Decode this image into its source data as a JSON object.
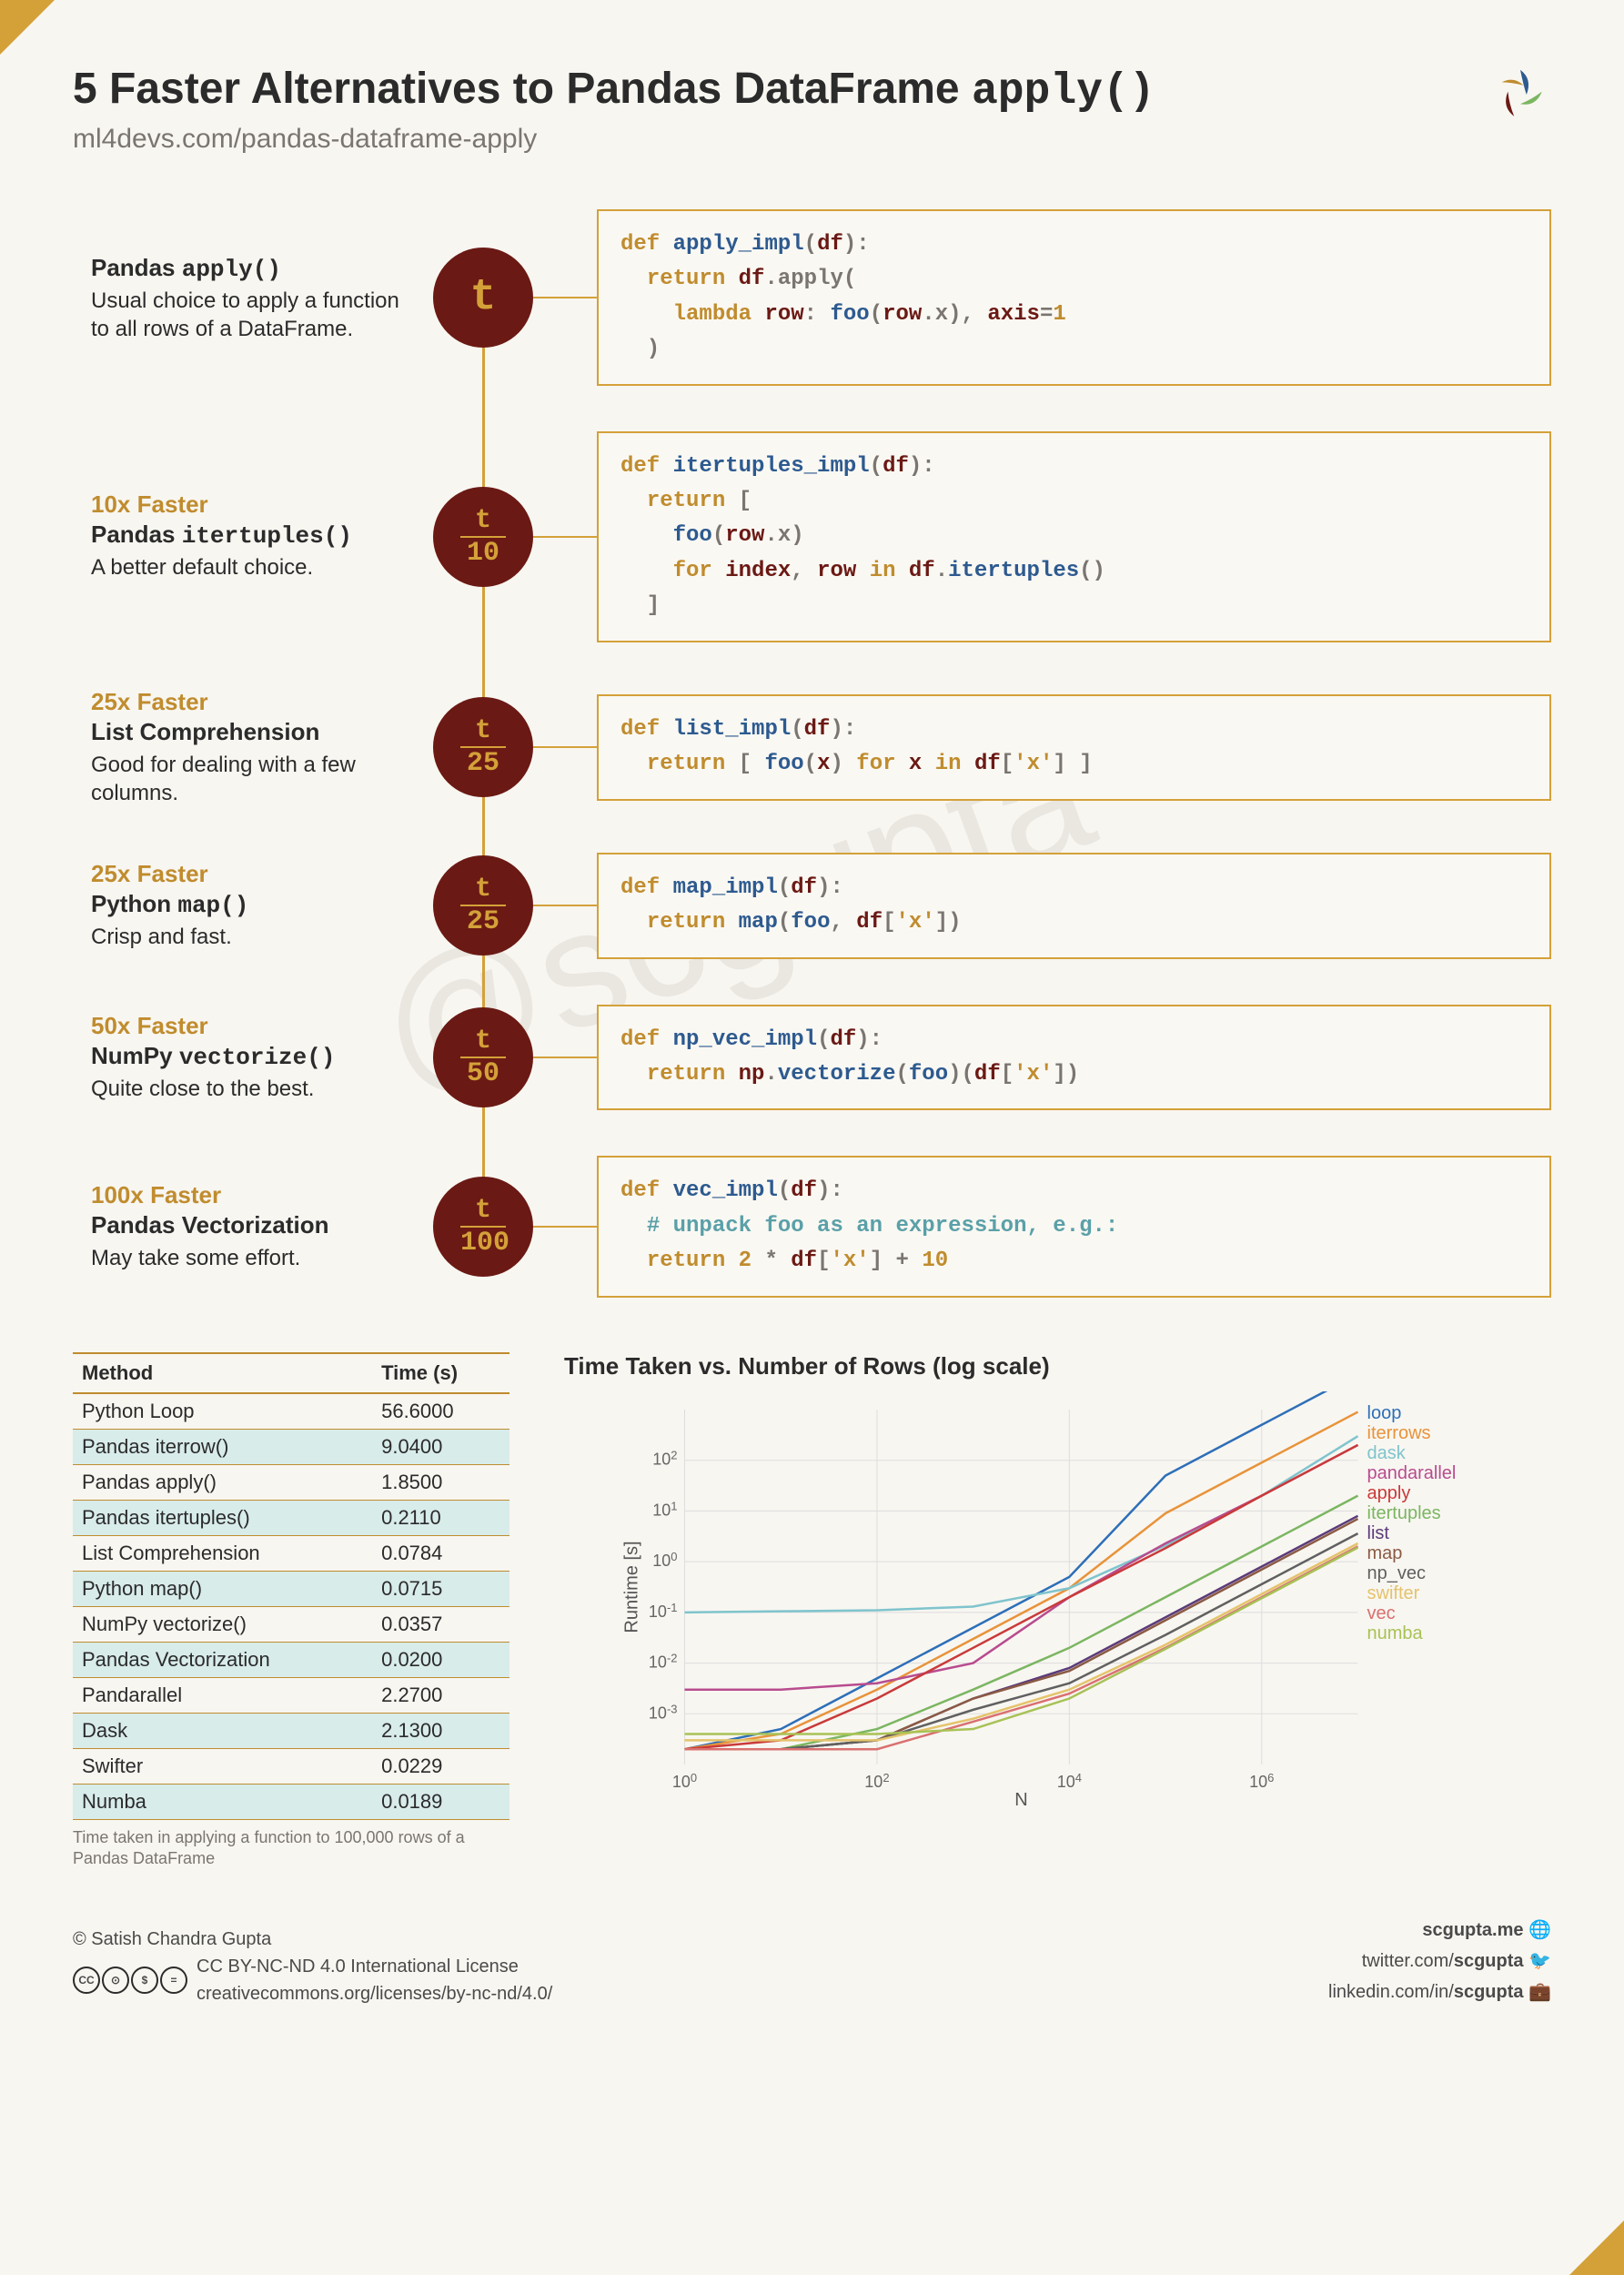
{
  "header": {
    "title_prefix": "5 Faster Alternatives to Pandas DataFrame ",
    "title_mono": "apply()",
    "subtitle": "ml4devs.com/pandas-dataframe-apply"
  },
  "methods": [
    {
      "speed": "",
      "title_text": "Pandas ",
      "title_mono": "apply()",
      "desc": "Usual choice to apply a function to all rows of a DataFrame.",
      "badge_t": "t",
      "badge_n": "",
      "code": "<span class='kw'>def</span> <span class='fn'>apply_impl</span>(<span class='var'>df</span>):\n  <span class='kw'>return</span> <span class='var'>df</span>.apply(\n    <span class='kw'>lambda</span> <span class='var'>row</span>: <span class='fn'>foo</span>(<span class='var'>row</span>.x), <span class='var'>axis</span>=<span class='op'>1</span>\n  )"
    },
    {
      "speed": "10x Faster",
      "title_text": "Pandas ",
      "title_mono": "itertuples()",
      "desc": "A better default choice.",
      "badge_t": "t",
      "badge_n": "10",
      "code": "<span class='kw'>def</span> <span class='fn'>itertuples_impl</span>(<span class='var'>df</span>):\n  <span class='kw'>return</span> [\n    <span class='fn'>foo</span>(<span class='var'>row</span>.x)\n    <span class='kw'>for</span> <span class='var'>index</span>, <span class='var'>row</span> <span class='kw'>in</span> <span class='var'>df</span>.<span class='fn'>itertuples</span>()\n  ]"
    },
    {
      "speed": "25x Faster",
      "title_text": "List Comprehension",
      "title_mono": "",
      "desc": "Good for dealing with a few columns.",
      "badge_t": "t",
      "badge_n": "25",
      "code": "<span class='kw'>def</span> <span class='fn'>list_impl</span>(<span class='var'>df</span>):\n  <span class='kw'>return</span> [ <span class='fn'>foo</span>(<span class='var'>x</span>) <span class='kw'>for</span> <span class='var'>x</span> <span class='kw'>in</span> <span class='var'>df</span>[<span class='op'>'x'</span>] ]"
    },
    {
      "speed": "25x Faster",
      "title_text": "Python ",
      "title_mono": "map()",
      "desc": "Crisp and fast.",
      "badge_t": "t",
      "badge_n": "25",
      "code": "<span class='kw'>def</span> <span class='fn'>map_impl</span>(<span class='var'>df</span>):\n  <span class='kw'>return</span> <span class='fn'>map</span>(<span class='fn'>foo</span>, <span class='var'>df</span>[<span class='op'>'x'</span>])"
    },
    {
      "speed": "50x Faster",
      "title_text": "NumPy ",
      "title_mono": "vectorize()",
      "desc": "Quite close to the best.",
      "badge_t": "t",
      "badge_n": "50",
      "code": "<span class='kw'>def</span> <span class='fn'>np_vec_impl</span>(<span class='var'>df</span>):\n  <span class='kw'>return</span> <span class='var'>np</span>.<span class='fn'>vectorize</span>(<span class='fn'>foo</span>)(<span class='var'>df</span>[<span class='op'>'x'</span>])"
    },
    {
      "speed": "100x Faster",
      "title_text": "Pandas Vectorization",
      "title_mono": "",
      "desc": "May take some effort.",
      "badge_t": "t",
      "badge_n": "100",
      "code": "<span class='kw'>def</span> <span class='fn'>vec_impl</span>(<span class='var'>df</span>):\n  <span style='color:#5aa0a8'># unpack foo as an expression, e.g.:</span>\n  <span class='kw'>return</span> <span class='op'>2</span> * <span class='var'>df</span>[<span class='op'>'x'</span>] + <span class='op'>10</span>"
    }
  ],
  "table_header": {
    "method": "Method",
    "time": "Time (s)"
  },
  "table_rows": [
    {
      "m": "Python Loop",
      "t": "56.6000"
    },
    {
      "m": "Pandas iterrow()",
      "t": "9.0400"
    },
    {
      "m": "Pandas apply()",
      "t": "1.8500"
    },
    {
      "m": "Pandas itertuples()",
      "t": "0.2110"
    },
    {
      "m": "List Comprehension",
      "t": "0.0784"
    },
    {
      "m": "Python map()",
      "t": "0.0715"
    },
    {
      "m": "NumPy vectorize()",
      "t": "0.0357"
    },
    {
      "m": "Pandas Vectorization",
      "t": "0.0200"
    },
    {
      "m": "Pandarallel",
      "t": "2.2700"
    },
    {
      "m": "Dask",
      "t": "2.1300"
    },
    {
      "m": "Swifter",
      "t": "0.0229"
    },
    {
      "m": "Numba",
      "t": "0.0189"
    }
  ],
  "table_caption": "Time taken in applying a function to 100,000 rows of a Pandas DataFrame",
  "chart_title": "Time Taken vs. Number of Rows (log scale)",
  "chart_data": {
    "type": "line",
    "xlabel": "N",
    "ylabel": "Runtime [s]",
    "xscale": "log",
    "yscale": "log",
    "xlim": [
      1,
      10000000.0
    ],
    "ylim": [
      0.0001,
      1000.0
    ],
    "x_ticks": [
      "10^0",
      "10^2",
      "10^4",
      "10^6"
    ],
    "y_ticks": [
      "10^-3",
      "10^-2",
      "10^-1",
      "10^0",
      "10^1",
      "10^2"
    ],
    "x": [
      1,
      10.0,
      100.0,
      1000.0,
      10000.0,
      100000.0,
      1000000.0,
      10000000.0
    ],
    "series": [
      {
        "name": "loop",
        "color": "#2d6fb8",
        "values": [
          0.0002,
          0.0005,
          0.005,
          0.05,
          0.5,
          50.0,
          500.0,
          5000.0
        ]
      },
      {
        "name": "iterrows",
        "color": "#e8933a",
        "values": [
          0.0002,
          0.0004,
          0.003,
          0.03,
          0.3,
          9,
          90.0,
          900.0
        ]
      },
      {
        "name": "dask",
        "color": "#7fc4cd",
        "values": [
          0.1,
          0.105,
          0.11,
          0.13,
          0.3,
          2.1,
          20.0,
          300.0
        ]
      },
      {
        "name": "pandarallel",
        "color": "#b84c8f",
        "values": [
          0.003,
          0.003,
          0.004,
          0.01,
          0.2,
          2.3,
          20.0,
          200.0
        ]
      },
      {
        "name": "apply",
        "color": "#c93a3a",
        "values": [
          0.0002,
          0.0003,
          0.002,
          0.02,
          0.2,
          1.85,
          20.0,
          200.0
        ]
      },
      {
        "name": "itertuples",
        "color": "#7bb661",
        "values": [
          0.0002,
          0.0002,
          0.0005,
          0.003,
          0.02,
          0.2,
          2,
          20.0
        ]
      },
      {
        "name": "list",
        "color": "#5b3b7a",
        "values": [
          0.0002,
          0.0002,
          0.0003,
          0.002,
          0.008,
          0.08,
          0.8,
          8
        ]
      },
      {
        "name": "map",
        "color": "#8b5a44",
        "values": [
          0.0002,
          0.0002,
          0.0003,
          0.002,
          0.007,
          0.07,
          0.7,
          7
        ]
      },
      {
        "name": "np_vec",
        "color": "#606060",
        "values": [
          0.0002,
          0.0002,
          0.0003,
          0.0012,
          0.004,
          0.036,
          0.36,
          3.6
        ]
      },
      {
        "name": "swifter",
        "color": "#e4c36b",
        "values": [
          0.0003,
          0.0003,
          0.0003,
          0.0008,
          0.003,
          0.023,
          0.23,
          2.3
        ]
      },
      {
        "name": "vec",
        "color": "#d97070",
        "values": [
          0.0002,
          0.0002,
          0.0002,
          0.0007,
          0.0025,
          0.02,
          0.2,
          2
        ]
      },
      {
        "name": "numba",
        "color": "#a8c256",
        "values": [
          0.0004,
          0.0004,
          0.0004,
          0.0005,
          0.002,
          0.019,
          0.19,
          1.9
        ]
      }
    ]
  },
  "footer": {
    "copyright": "© Satish Chandra Gupta",
    "license": "CC BY-NC-ND 4.0 International License",
    "license_url": "creativecommons.org/licenses/by-nc-nd/4.0/",
    "link1": "scgupta.me",
    "link2_prefix": "twitter.com/",
    "link2_bold": "scgupta",
    "link3_prefix": "linkedin.com/in/",
    "link3_bold": "scgupta"
  }
}
